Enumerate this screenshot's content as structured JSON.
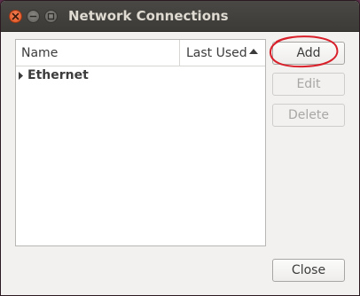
{
  "window": {
    "title": "Network Connections"
  },
  "list": {
    "columns": [
      {
        "label": "Name"
      },
      {
        "label": "Last Used",
        "sort": "ascending"
      }
    ],
    "rows": [
      {
        "label": "Ethernet",
        "expanded": false
      }
    ]
  },
  "actions": {
    "add_label": "Add",
    "edit_label": "Edit",
    "delete_label": "Delete",
    "close_label": "Close"
  },
  "colors": {
    "titlebar": "#3c3b37",
    "close_button": "#e0531f",
    "annotation": "#d9202a"
  },
  "icons": {
    "close": "close-icon",
    "minimize": "minimize-icon",
    "maximize": "maximize-icon",
    "sort": "sort-ascending-icon",
    "expander": "expander-collapsed-icon"
  }
}
